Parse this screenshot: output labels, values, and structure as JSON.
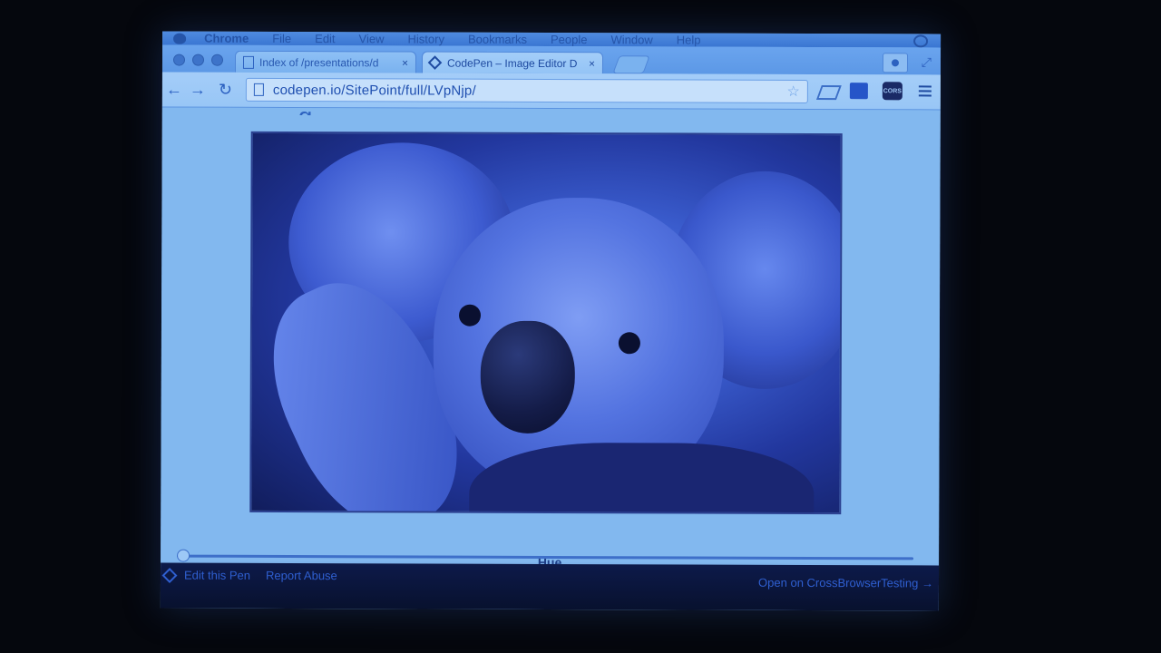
{
  "menubar": {
    "app": "Chrome",
    "items": [
      "File",
      "Edit",
      "View",
      "History",
      "Bookmarks",
      "People",
      "Window",
      "Help"
    ]
  },
  "tabs": [
    {
      "title": "Index of /presentations/d",
      "close": "×"
    },
    {
      "title": "CodePen – Image Editor D",
      "close": "×"
    }
  ],
  "toolbar": {
    "back": "←",
    "forward": "→",
    "reload": "↻",
    "url": "codepen.io/SitePoint/full/LVpNjp/",
    "star": "☆",
    "cors_label": "CORS"
  },
  "page": {
    "heading_fragment": "g",
    "slider_label": "Hue",
    "slider_value": 0
  },
  "footer": {
    "edit": "Edit this Pen",
    "report": "Report Abuse",
    "cbt": "Open on CrossBrowserTesting →"
  }
}
